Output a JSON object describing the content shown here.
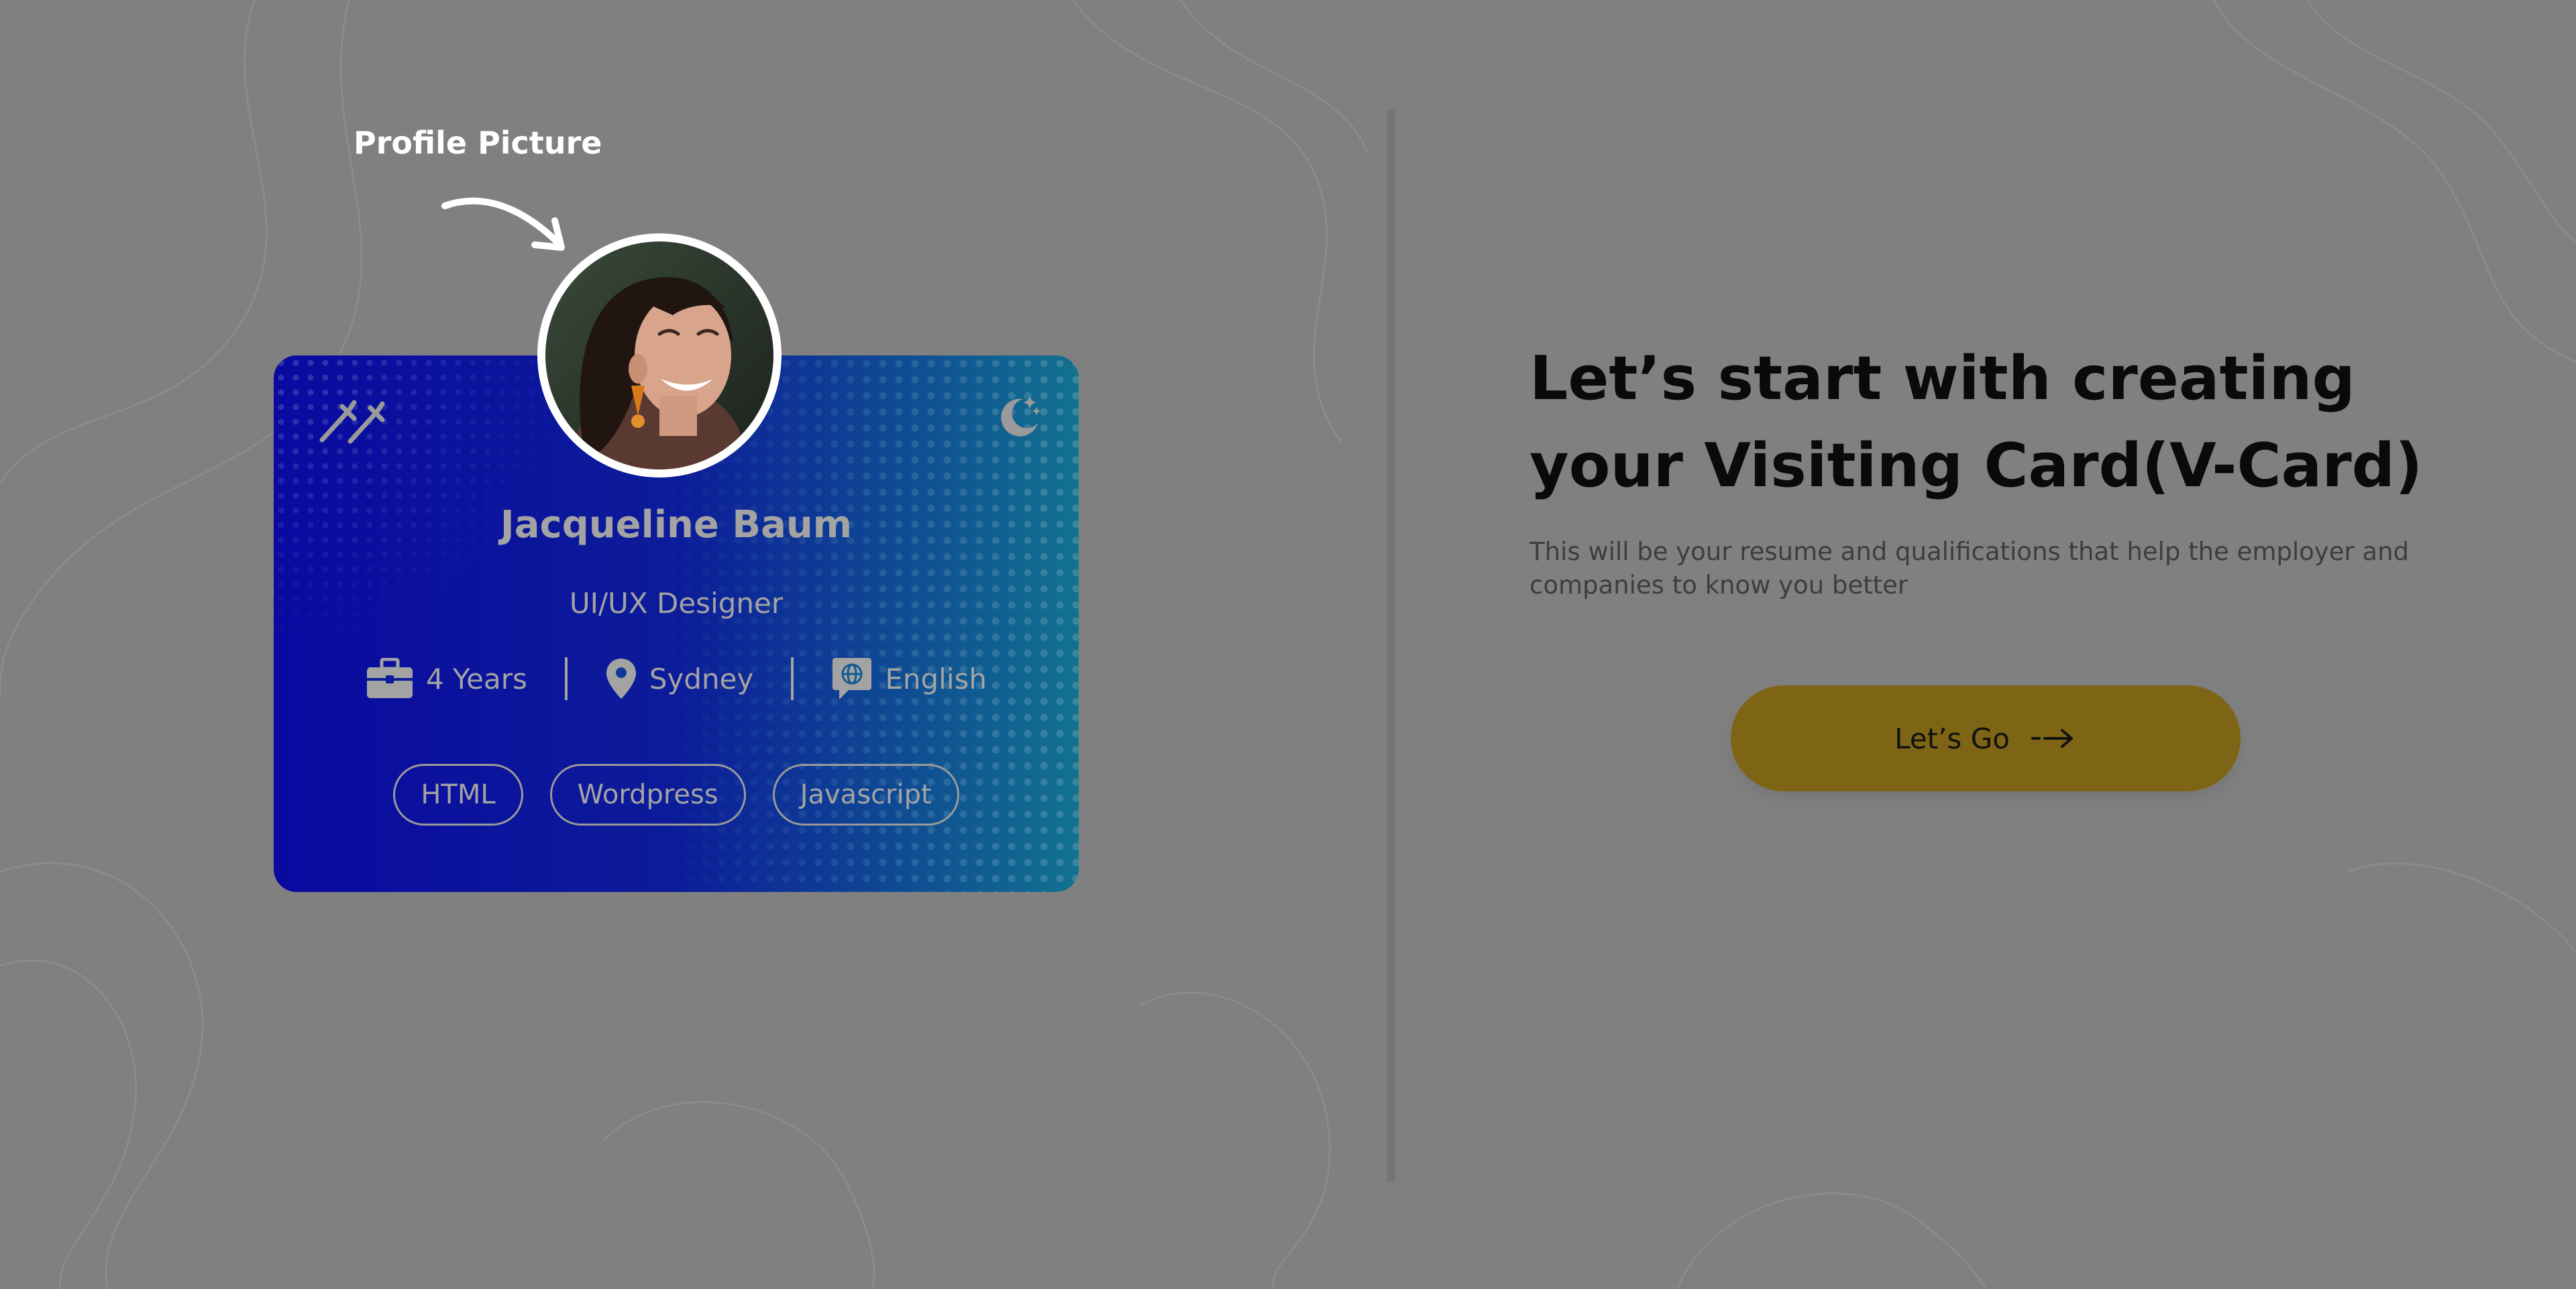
{
  "callout": {
    "label": "Profile Picture"
  },
  "card": {
    "name": "Jacqueline Baum",
    "role": "UI/UX Designer",
    "experience": "4 Years",
    "location": "Sydney",
    "language": "English",
    "skills": [
      "HTML",
      "Wordpress",
      "Javascript"
    ],
    "icons": {
      "top_left": "tools-icon",
      "top_right": "moon-icon",
      "experience": "briefcase-icon",
      "location": "location-pin-icon",
      "language": "globe-chat-icon"
    }
  },
  "intro": {
    "headline_line1": "Let’s start with creating",
    "headline_line2": "your Visiting Card(V-Card)",
    "description": "This will be your resume and qualifications that help the employer and companies to know you better",
    "cta_label": "Let’s Go",
    "cta_icon": "arrow-right-icon"
  },
  "colors": {
    "overlay": "#808080",
    "card_start": "#0a0aa0",
    "card_end": "#12728f",
    "cta_background": "#7d6515",
    "headline": "#0a0a0a"
  }
}
